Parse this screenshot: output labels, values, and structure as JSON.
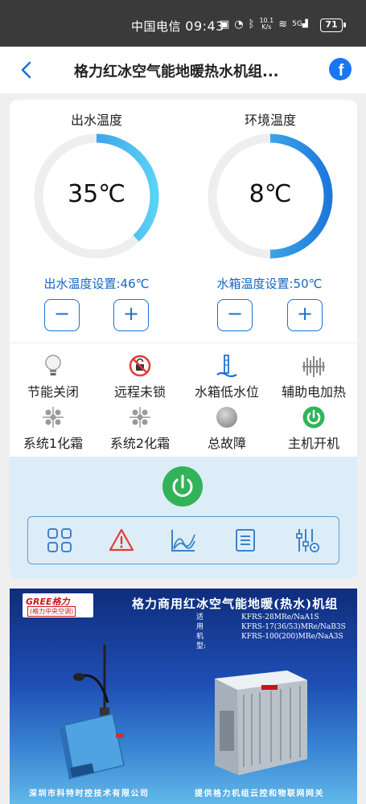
{
  "status_bar": {
    "carrier": "中国电信",
    "time": "09:43",
    "net_speed_value": "10.1",
    "net_speed_unit": "K/s",
    "signal": "5G",
    "battery": "71"
  },
  "header": {
    "title": "格力红冰空气能地暖热水机组...",
    "back_icon": "back-chevron",
    "share_icon": "facebook-icon"
  },
  "gauges": [
    {
      "label": "出水温度",
      "value": "35℃",
      "level": 0.38
    },
    {
      "label": "环境温度",
      "value": "8℃",
      "level": 0.5
    }
  ],
  "setpoints": {
    "outlet": "出水温度设置:46℃",
    "tank": "水箱温度设置:50℃",
    "minus": "−",
    "plus": "+"
  },
  "status_items": [
    {
      "label": "节能关闭",
      "icon": "bulb-icon"
    },
    {
      "label": "远程未锁",
      "icon": "unlocked-icon"
    },
    {
      "label": "水箱低水位",
      "icon": "water-level-icon"
    },
    {
      "label": "辅助电加热",
      "icon": "heater-icon"
    },
    {
      "label": "系统1化霜",
      "icon": "defrost-icon"
    },
    {
      "label": "系统2化霜",
      "icon": "defrost-icon"
    },
    {
      "label": "总故障",
      "icon": "fault-icon"
    },
    {
      "label": "主机开机",
      "icon": "power-on-icon"
    }
  ],
  "toolbar": [
    "grid-icon",
    "warning-icon",
    "chart-icon",
    "list-icon",
    "settings-icon"
  ],
  "banner": {
    "brand": "GREE格力",
    "brand_sub": "(格力中央空调)",
    "title": "格力商用红冰空气能地暖(热水)机组",
    "models_label": "适用机型:",
    "models": [
      "KFRS-28MRe/NaA1S",
      "KFRS-17(36/53)MRe/NaB3S",
      "KFRS-100(200)MRe/NaA3S"
    ],
    "footer_left": "深圳市科特时控技术有限公司",
    "footer_right": "提供格力机组云控和物联网网关"
  },
  "colors": {
    "accent": "#1e6fd0",
    "gauge_start": "#1e78dc",
    "gauge_end": "#5ad1f5",
    "power_green": "#32b35a",
    "alert_red": "#e53935"
  }
}
